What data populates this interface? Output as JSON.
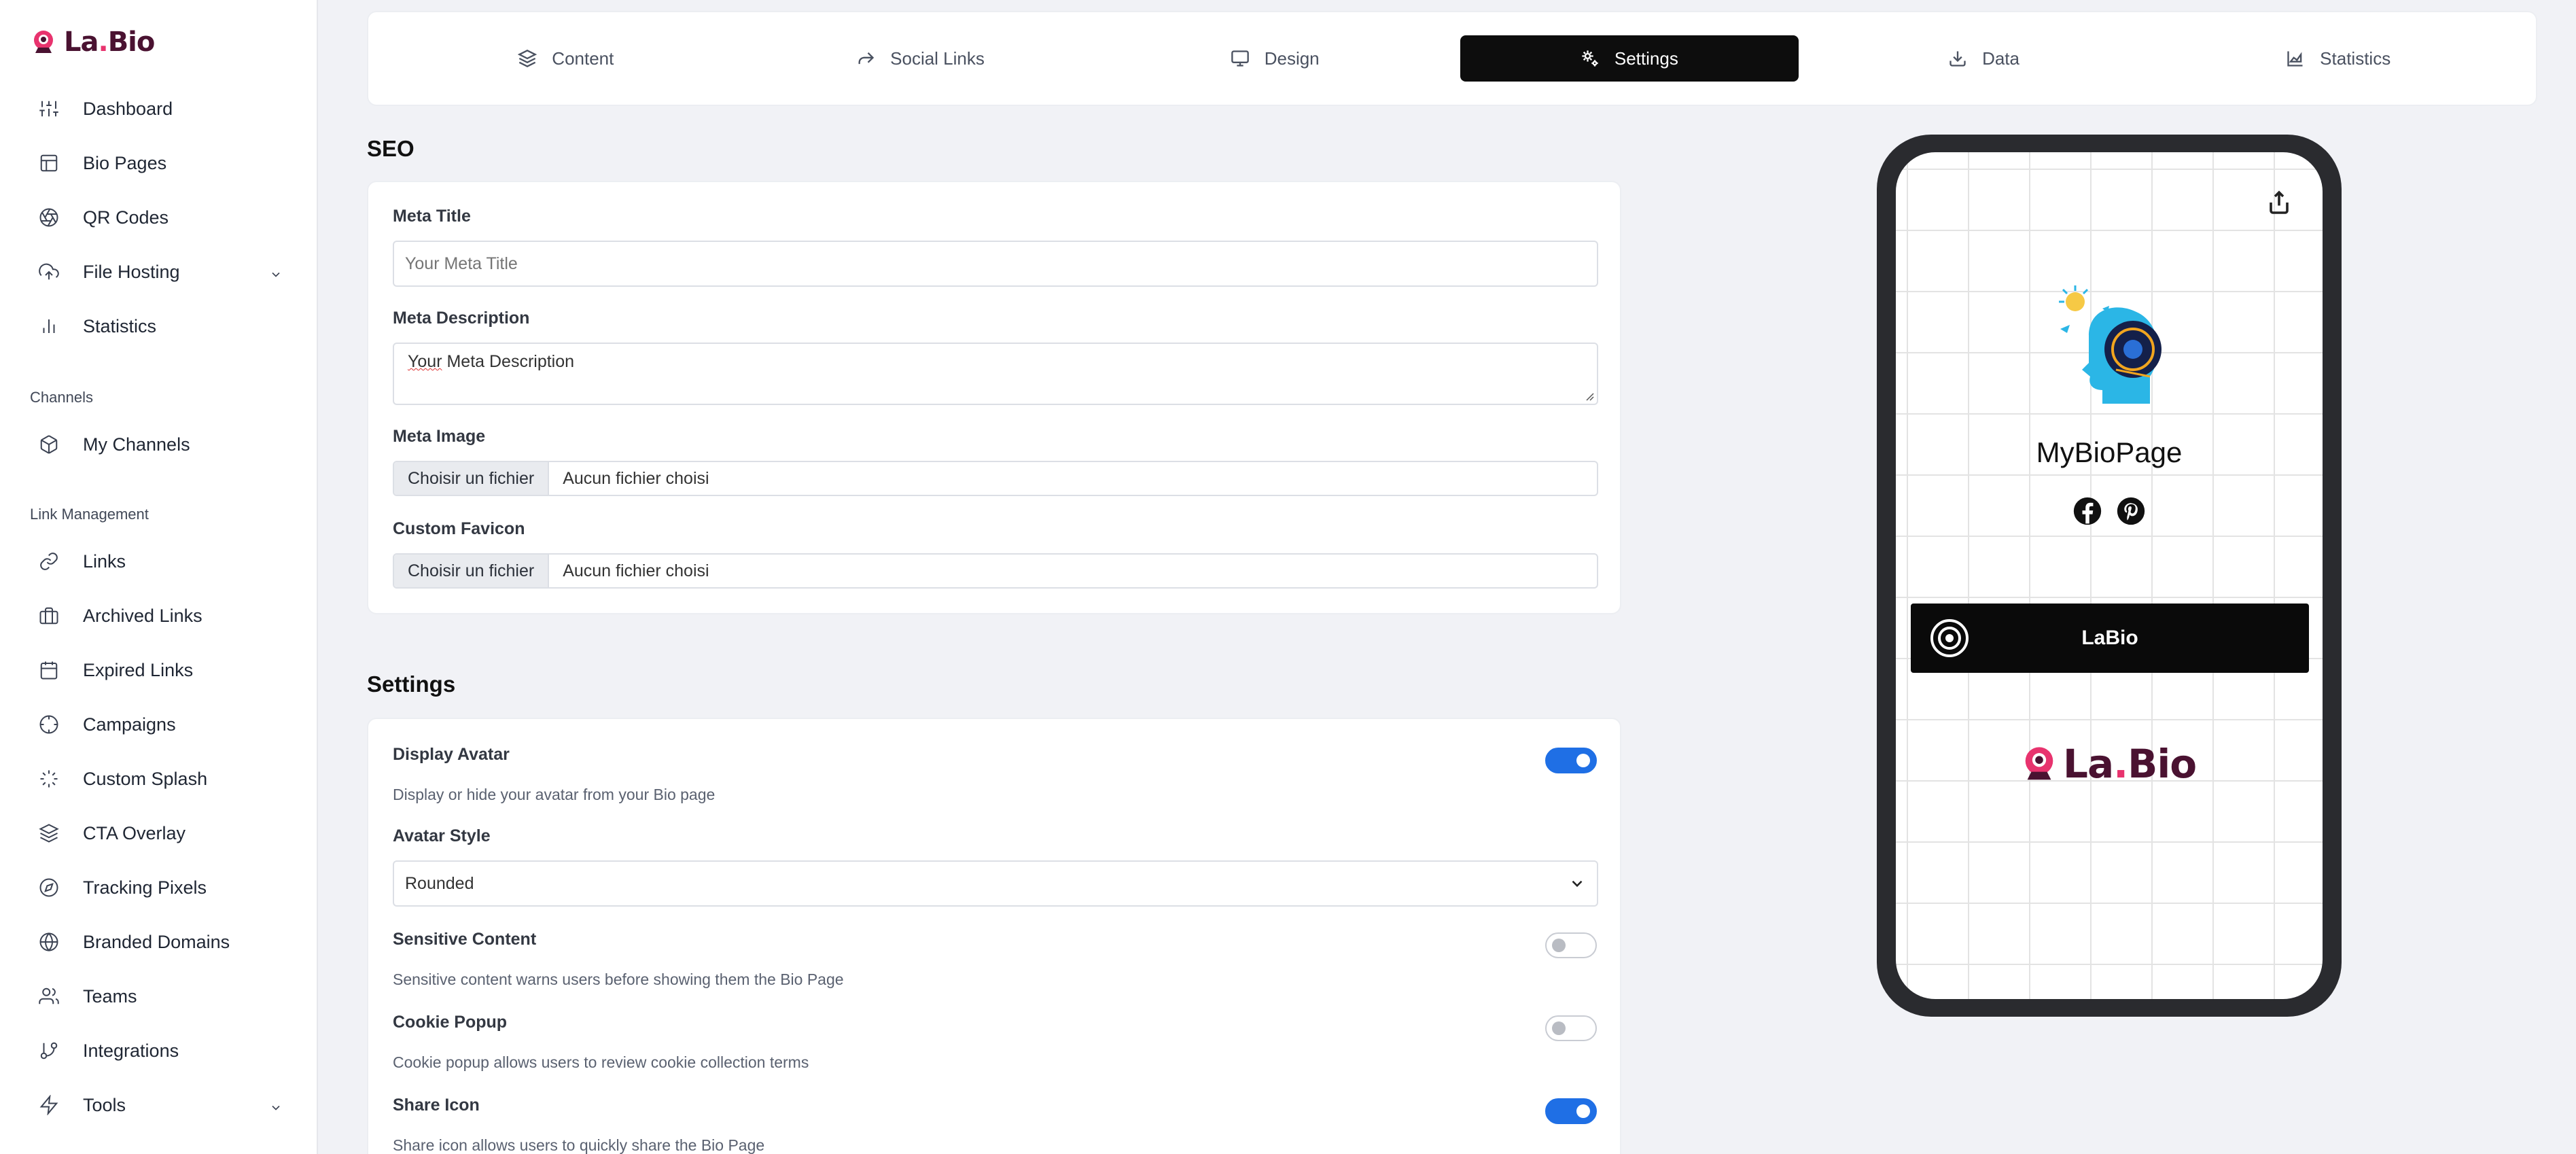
{
  "brand": {
    "name_part1": "La",
    "name_dot": ".",
    "name_part2": "Bio",
    "accent": "#e8336e",
    "dark": "#4a1231"
  },
  "sidebar": {
    "items_top": [
      {
        "label": "Dashboard",
        "icon": "sliders-icon"
      },
      {
        "label": "Bio Pages",
        "icon": "layout-icon"
      },
      {
        "label": "QR Codes",
        "icon": "aperture-icon"
      },
      {
        "label": "File Hosting",
        "icon": "upload-cloud-icon",
        "has_children": true
      },
      {
        "label": "Statistics",
        "icon": "bar-chart-icon"
      }
    ],
    "channels_label": "Channels",
    "channels_items": [
      {
        "label": "My Channels",
        "icon": "box-icon"
      }
    ],
    "link_mgmt_label": "Link Management",
    "link_items": [
      {
        "label": "Links",
        "icon": "link-icon"
      },
      {
        "label": "Archived Links",
        "icon": "briefcase-icon"
      },
      {
        "label": "Expired Links",
        "icon": "calendar-icon"
      },
      {
        "label": "Campaigns",
        "icon": "crosshair-icon"
      },
      {
        "label": "Custom Splash",
        "icon": "loader-icon"
      },
      {
        "label": "CTA Overlay",
        "icon": "layers-icon"
      },
      {
        "label": "Tracking Pixels",
        "icon": "compass-icon"
      },
      {
        "label": "Branded Domains",
        "icon": "globe-icon"
      },
      {
        "label": "Teams",
        "icon": "users-icon"
      },
      {
        "label": "Integrations",
        "icon": "git-branch-icon"
      },
      {
        "label": "Tools",
        "icon": "zap-icon",
        "has_children": true
      }
    ]
  },
  "tabs": [
    {
      "label": "Content",
      "icon": "layers-icon",
      "active": false
    },
    {
      "label": "Social Links",
      "icon": "share-arrow-icon",
      "active": false
    },
    {
      "label": "Design",
      "icon": "monitor-icon",
      "active": false
    },
    {
      "label": "Settings",
      "icon": "cogs-icon",
      "active": true
    },
    {
      "label": "Data",
      "icon": "download-icon",
      "active": false
    },
    {
      "label": "Statistics",
      "icon": "area-chart-icon",
      "active": false
    }
  ],
  "seo": {
    "title": "SEO",
    "meta_title_label": "Meta Title",
    "meta_title_placeholder": "Your Meta Title",
    "meta_description_label": "Meta Description",
    "meta_description_placeholder_word1": "Your",
    "meta_description_placeholder_rest": " Meta Description",
    "meta_image_label": "Meta Image",
    "favicon_label": "Custom Favicon",
    "file_button": "Choisir un fichier",
    "file_none": "Aucun fichier choisi"
  },
  "settings": {
    "title": "Settings",
    "display_avatar_label": "Display Avatar",
    "display_avatar_desc": "Display or hide your avatar from your Bio page",
    "display_avatar_on": true,
    "avatar_style_label": "Avatar Style",
    "avatar_style_value": "Rounded",
    "sensitive_label": "Sensitive Content",
    "sensitive_desc": "Sensitive content warns users before showing them the Bio Page",
    "sensitive_on": false,
    "cookie_label": "Cookie Popup",
    "cookie_desc": "Cookie popup allows users to review cookie collection terms",
    "cookie_on": false,
    "share_label": "Share Icon",
    "share_desc": "Share icon allows users to quickly share the Bio Page",
    "share_on": true
  },
  "preview": {
    "name": "MyBioPage",
    "socials": [
      "facebook-icon",
      "pinterest-icon"
    ],
    "link_label": "LaBio",
    "link_icon": "target-icon"
  },
  "colors": {
    "toggle_on": "#1f6fe5",
    "tab_active_bg": "#0d0d0d"
  }
}
